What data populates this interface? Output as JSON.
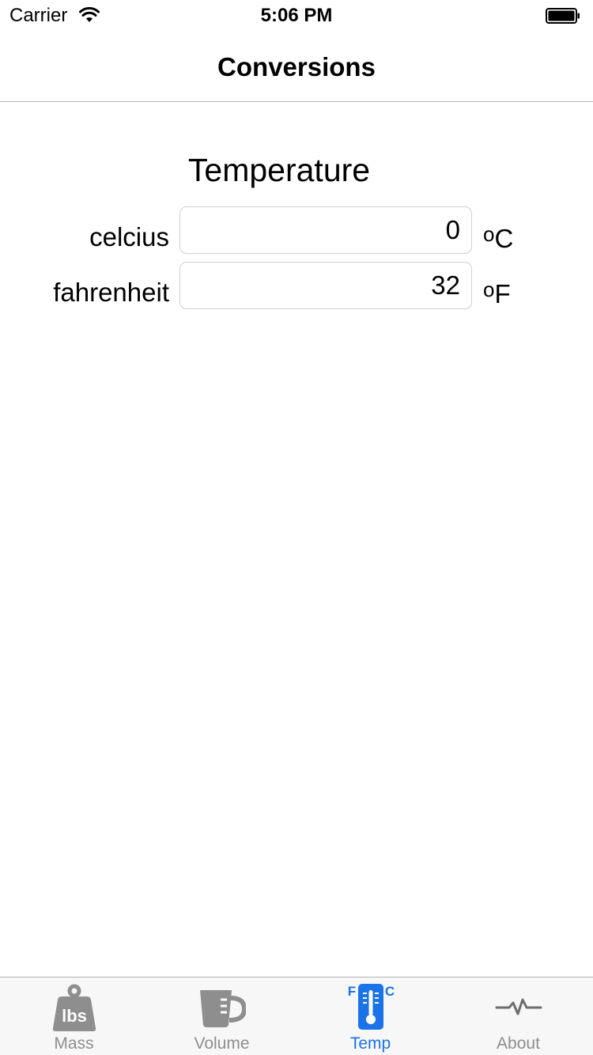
{
  "status_bar": {
    "carrier": "Carrier",
    "time": "5:06 PM",
    "wifi_icon": "wifi-icon",
    "battery_icon": "battery-icon"
  },
  "nav": {
    "title": "Conversions"
  },
  "content": {
    "section_title": "Temperature",
    "fields": [
      {
        "label": "celcius",
        "value": "0",
        "unit_degree": "o",
        "unit_letter": "C"
      },
      {
        "label": "fahrenheit",
        "value": "32",
        "unit_degree": "o",
        "unit_letter": "F"
      }
    ]
  },
  "tab_bar": {
    "active_color": "#1a73e8",
    "inactive_color": "#8e8e8e",
    "tabs": [
      {
        "label": "Mass",
        "icon": "weight-lbs-icon",
        "icon_text": "lbs",
        "active": false
      },
      {
        "label": "Volume",
        "icon": "measuring-cup-icon",
        "active": false
      },
      {
        "label": "Temp",
        "icon": "thermometer-icon",
        "icon_left_letter": "F",
        "icon_right_letter": "C",
        "active": true
      },
      {
        "label": "About",
        "icon": "pulse-icon",
        "active": false
      }
    ]
  }
}
